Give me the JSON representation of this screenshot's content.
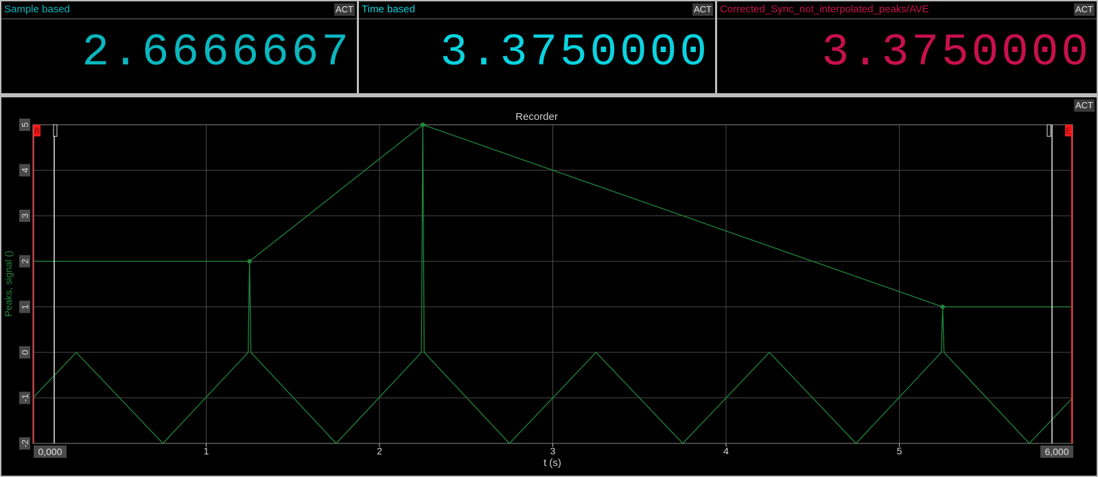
{
  "colors": {
    "cyan": "#0bb7bf",
    "crimson": "#c8104f",
    "trace": "#1f8a3c",
    "grid": "#4a4a4a",
    "cursor_red": "#ff2d2d"
  },
  "digital_meters": [
    {
      "title": "Sample based",
      "act": "ACT",
      "value": "2.6666667",
      "color": "#0bb7bf"
    },
    {
      "title": "Time based",
      "act": "ACT",
      "value": "3.3750000",
      "color": "#0bd3df"
    },
    {
      "title": "Corrected_Sync_not_interpolated_peaks/AVE",
      "act": "ACT",
      "value": "3.3750000",
      "color": "#c8104f"
    }
  ],
  "recorder": {
    "title": "Recorder",
    "act": "ACT",
    "cursor_start_tag": "B",
    "cursor_end_tag": "E",
    "range_start_label": "0,000",
    "range_end_label": "6,000"
  },
  "chart_data": {
    "type": "line",
    "title": "Recorder",
    "xlabel": "t (s)",
    "ylabel": "Peaks, signal ()",
    "xlim": [
      0,
      6
    ],
    "ylim": [
      -2,
      5
    ],
    "x_ticks": [
      "1",
      "2",
      "3",
      "4",
      "5"
    ],
    "y_ticks": [
      "5",
      "4",
      "3",
      "2",
      "1",
      "0",
      "-1",
      "-2"
    ],
    "grid": true,
    "series": [
      {
        "name": "signal",
        "x": [
          0,
          0.25,
          0.75,
          1.25,
          1.75,
          2.25,
          2.75,
          3.25,
          3.75,
          4.25,
          4.75,
          5.25,
          5.75,
          6
        ],
        "y": [
          -1,
          0,
          -2,
          0,
          -2,
          0,
          -2,
          0,
          -2,
          0,
          -2,
          0,
          -2,
          -1
        ],
        "spikes": [
          {
            "x": 1.25,
            "y": 2
          },
          {
            "x": 2.25,
            "y": 5
          },
          {
            "x": 5.25,
            "y": 1
          }
        ]
      },
      {
        "name": "peaks",
        "x": [
          0,
          1.25,
          2.25,
          5.25,
          6
        ],
        "y": [
          2,
          2,
          5,
          1,
          1
        ],
        "markers": [
          {
            "x": 1.25,
            "y": 2
          },
          {
            "x": 2.25,
            "y": 5
          },
          {
            "x": 5.25,
            "y": 1
          }
        ]
      }
    ]
  }
}
